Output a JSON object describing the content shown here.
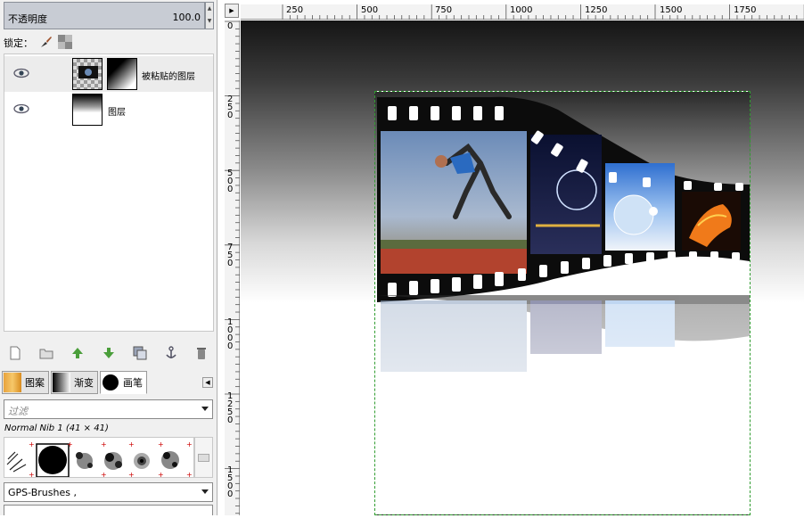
{
  "layers_panel": {
    "opacity_label": "不透明度",
    "opacity_value": "100.0",
    "lock_label": "锁定：",
    "layers": [
      {
        "name": "被粘贴的图层",
        "selected": true
      },
      {
        "name": "图层",
        "selected": false
      }
    ]
  },
  "brush_panel": {
    "tabs": [
      {
        "label": "图案"
      },
      {
        "label": "渐变"
      },
      {
        "label": "画笔"
      }
    ],
    "filter_placeholder": "过滤",
    "brush_name": "Normal Nib 1 (41 × 41)",
    "brush_set": "GPS-Brushes ,"
  },
  "rulers": {
    "horizontal_ticks": [
      "250",
      "500",
      "750",
      "1000",
      "1250",
      "1500",
      "1750"
    ],
    "vertical_ticks": [
      "0",
      "250",
      "500",
      "750",
      "1000",
      "1250",
      "1500"
    ]
  },
  "colors": {
    "selection_border": "#2f9c2f",
    "panel_bg": "#f0f0f0"
  }
}
